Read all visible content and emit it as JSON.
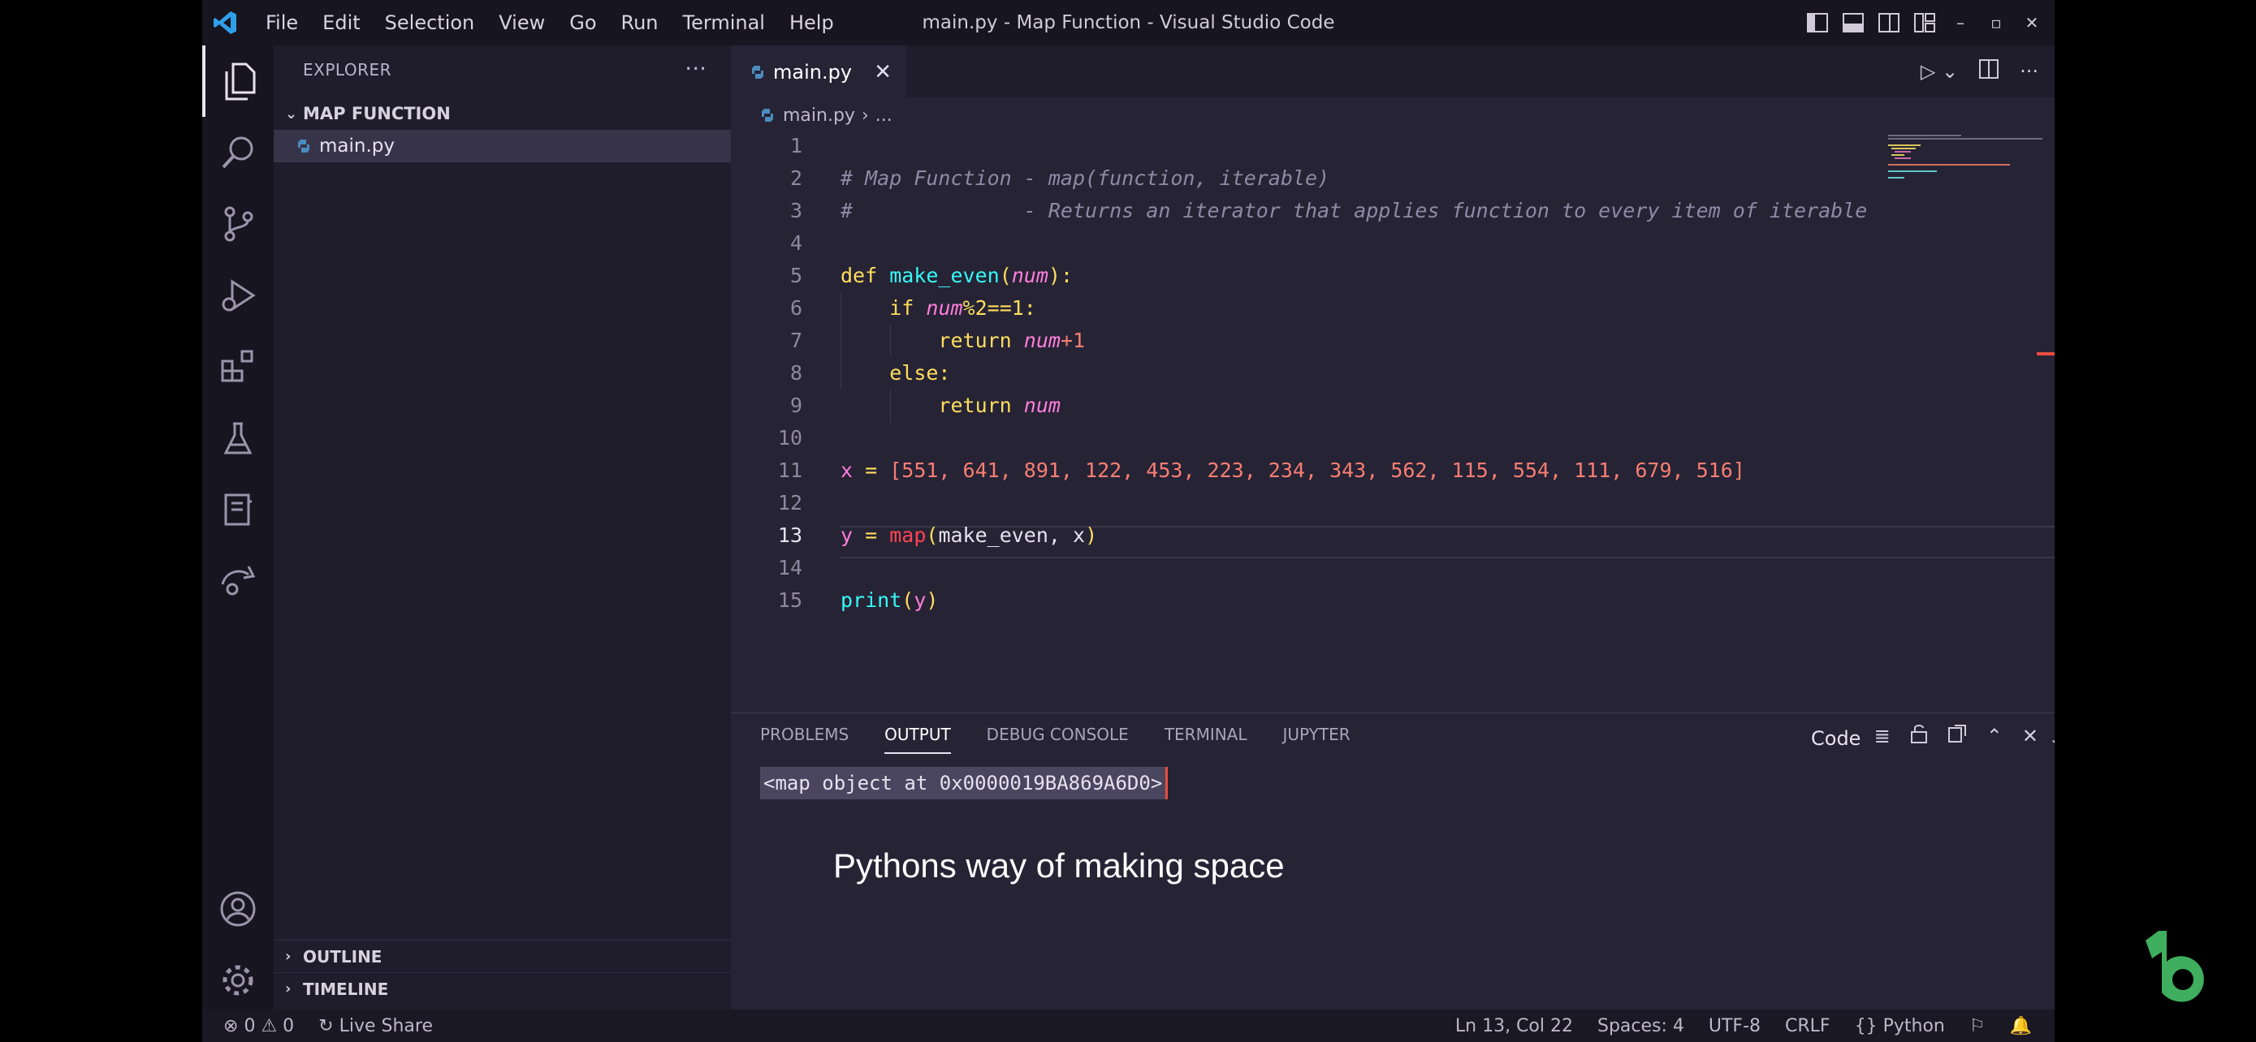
{
  "window": {
    "title": "main.py - Map Function - Visual Studio Code",
    "menu": [
      "File",
      "Edit",
      "Selection",
      "View",
      "Go",
      "Run",
      "Terminal",
      "Help"
    ]
  },
  "sidebar": {
    "header": "EXPLORER",
    "folder": "MAP FUNCTION",
    "file": "main.py",
    "outline": "OUTLINE",
    "timeline": "TIMELINE"
  },
  "editor": {
    "tab": "main.py",
    "breadcrumb_file": "main.py",
    "breadcrumb_more": "...",
    "line_numbers": [
      "1",
      "2",
      "3",
      "4",
      "5",
      "6",
      "7",
      "8",
      "9",
      "10",
      "11",
      "12",
      "13",
      "14",
      "15"
    ],
    "current_line": "13",
    "code": {
      "l2": "# Map Function - map(function, iterable)",
      "l3": "#              - Returns an iterator that applies function to every item of iterable",
      "l5_def": "def",
      "l5_name": "make_even",
      "l5_param": "num",
      "l6_if": "if",
      "l6_var": "num",
      "l6_expr": "%2==1:",
      "l7_ret": "return",
      "l7_var": "num",
      "l7_expr": "+1",
      "l8_else": "else:",
      "l9_ret": "return",
      "l9_var": "num",
      "l11_var": "x",
      "l11_op": " = ",
      "l11_list": "[551, 641, 891, 122, 453, 223, 234, 343, 562, 115, 554, 111, 679, 516]",
      "l13_var": "y",
      "l13_op": " = ",
      "l13_map": "map",
      "l13_args": "make_even, x",
      "l15_print": "print",
      "l15_arg": "y"
    }
  },
  "panel": {
    "tabs": [
      "PROBLEMS",
      "OUTPUT",
      "DEBUG CONSOLE",
      "TERMINAL",
      "JUPYTER"
    ],
    "active_tab": "OUTPUT",
    "channel": "Code",
    "output_line": "<map object at 0x0000019BA869A6D0>",
    "caption": "Pythons way of making space"
  },
  "status": {
    "errors": "0",
    "warnings": "0",
    "live_share": "Live Share",
    "position": "Ln 13, Col 22",
    "spaces": "Spaces: 4",
    "encoding": "UTF-8",
    "eol": "CRLF",
    "language": "Python"
  },
  "colors": {
    "editor_bg": "#262335",
    "sidebar_bg": "#1f1d2c",
    "keyword": "#fede5d",
    "function": "#36f9f6",
    "param": "#ff7edb",
    "number": "#f97e72"
  }
}
